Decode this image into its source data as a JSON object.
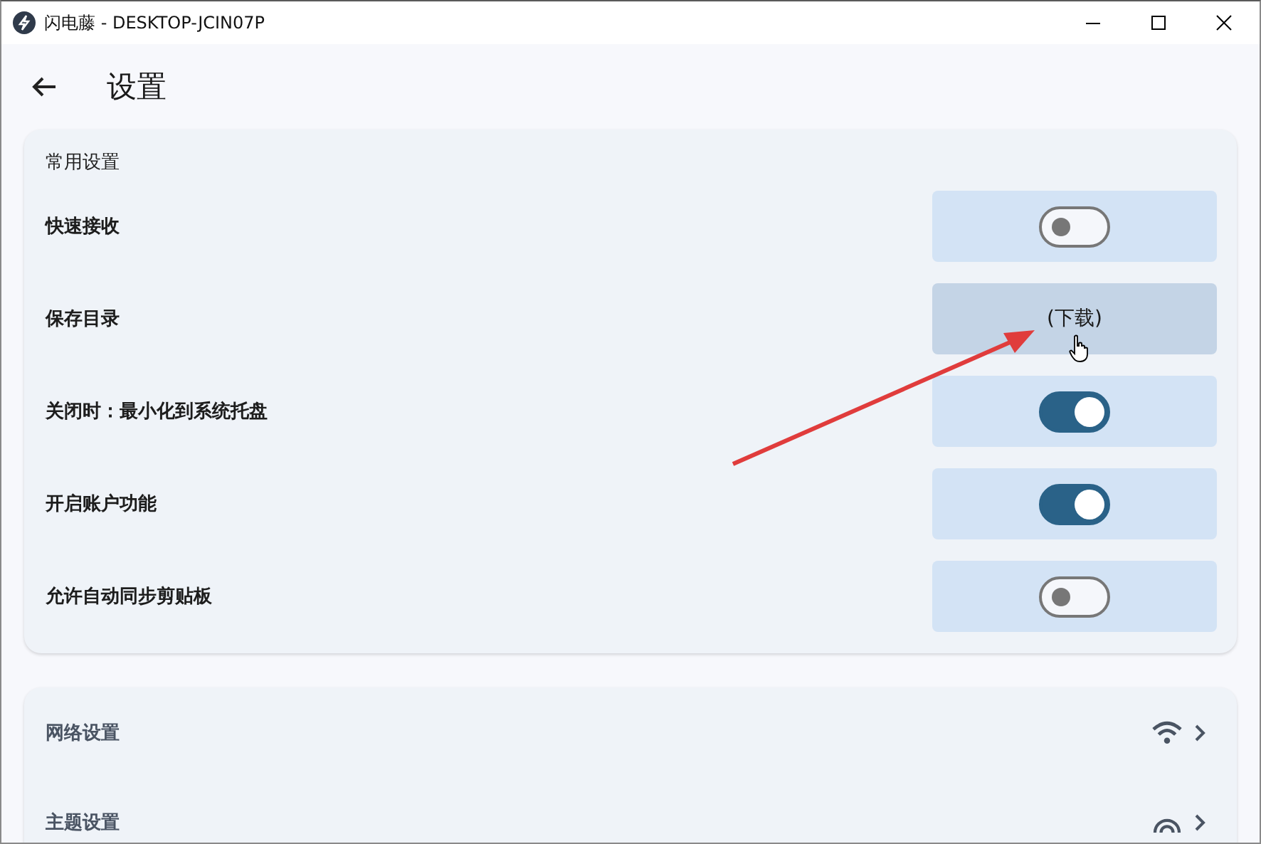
{
  "window": {
    "title": "闪电藤 - DESKTOP-JCIN07P"
  },
  "page": {
    "title": "设置"
  },
  "common": {
    "title": "常用设置",
    "rows": [
      {
        "label": "快速接收",
        "kind": "toggle",
        "on": false
      },
      {
        "label": "保存目录",
        "kind": "button",
        "value": "(下载)"
      },
      {
        "label": "关闭时：最小化到系统托盘",
        "kind": "toggle",
        "on": true
      },
      {
        "label": "开启账户功能",
        "kind": "toggle",
        "on": true
      },
      {
        "label": "允许自动同步剪贴板",
        "kind": "toggle",
        "on": false
      }
    ]
  },
  "more": [
    {
      "label": "网络设置",
      "kind": "network"
    },
    {
      "label": "主题设置",
      "kind": "theme"
    }
  ]
}
